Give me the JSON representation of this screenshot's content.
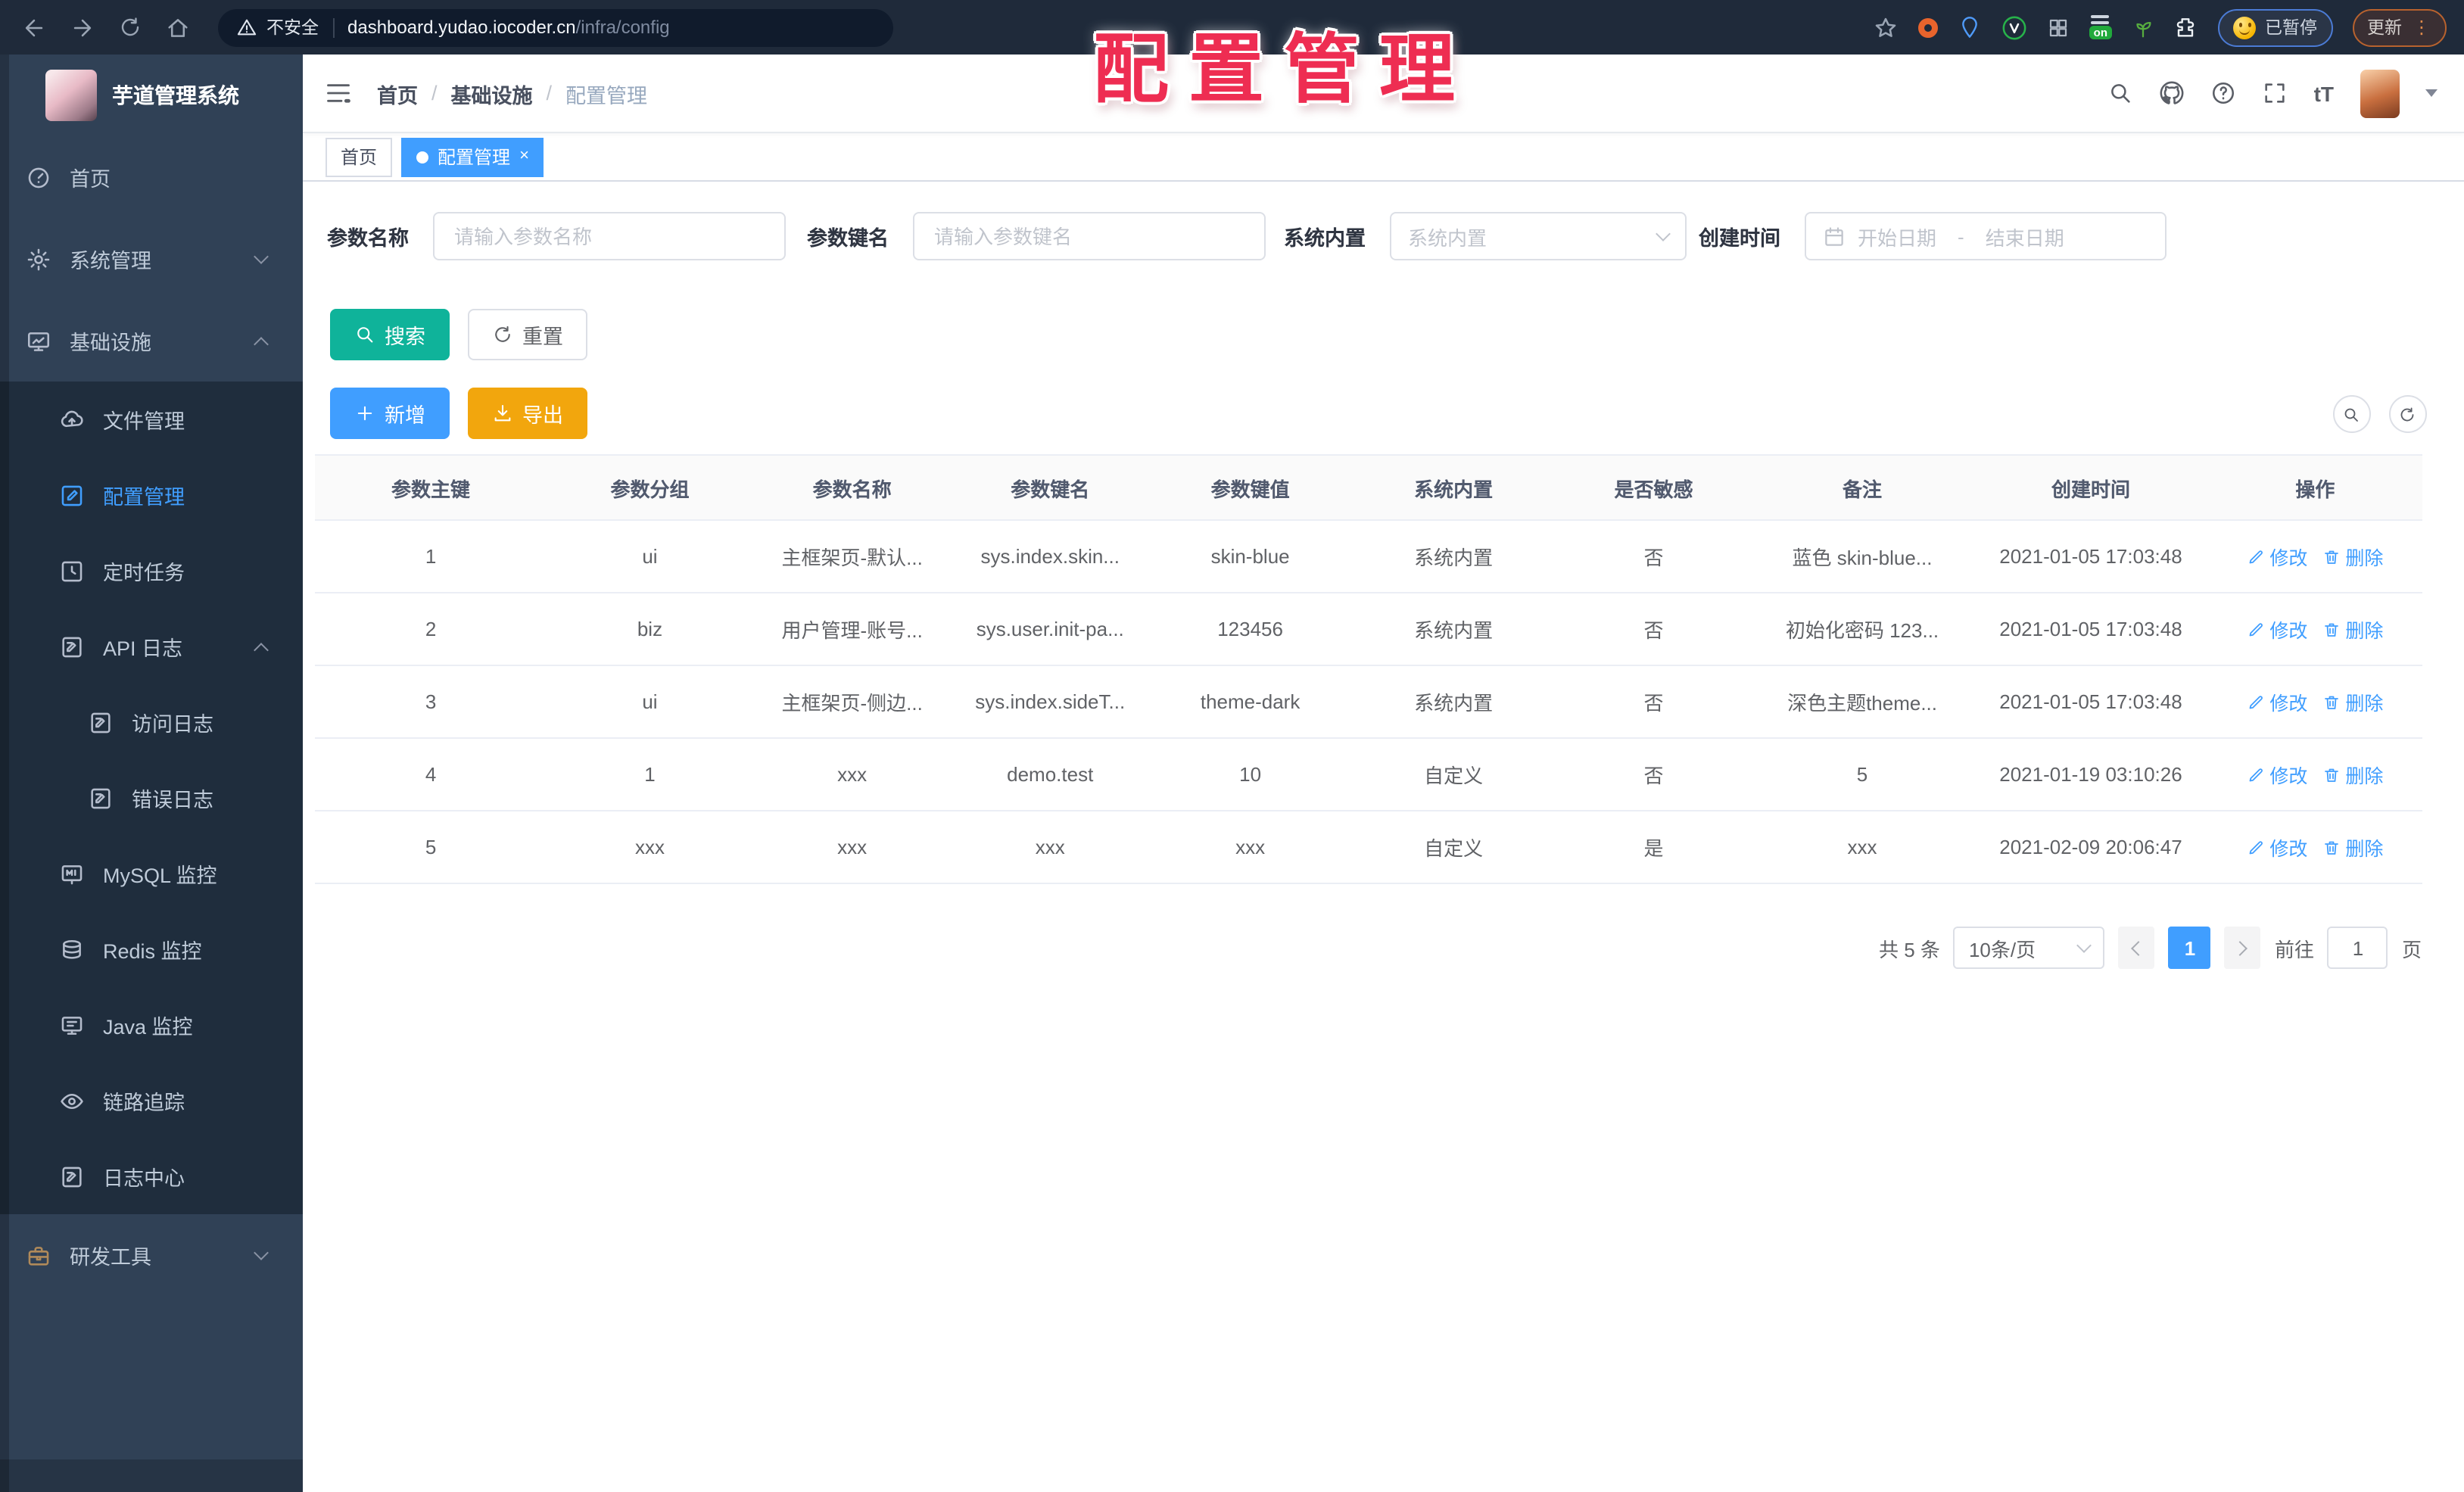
{
  "browser": {
    "security_label": "不安全",
    "url_host": "dashboard.yudao.iocoder.cn",
    "url_path": "/infra/config",
    "extension_on_badge": "on",
    "paused_pill": "已暂停",
    "update_button": "更新",
    "menu_dots": "⋮"
  },
  "watermark": "配置管理",
  "colors": {
    "accent_blue": "#409eff",
    "search_teal": "#0fb39a",
    "export_amber": "#f2a60d",
    "watermark_red": "#ee2d52",
    "sidebar_bg": "#304156",
    "submenu_bg": "#1f2d3d"
  },
  "sidebar": {
    "logo_title": "芋道管理系统",
    "menu": [
      {
        "label": "首页",
        "icon": "dashboard-icon"
      },
      {
        "label": "系统管理",
        "icon": "gear-icon",
        "arrow": "down"
      },
      {
        "label": "基础设施",
        "icon": "infra-monitor-icon",
        "arrow": "up"
      },
      {
        "label": "文件管理",
        "icon": "cloud-upload-icon"
      },
      {
        "label": "配置管理",
        "icon": "edit-square-icon",
        "active": true
      },
      {
        "label": "定时任务",
        "icon": "timer-icon"
      },
      {
        "label": "API 日志",
        "icon": "doc-log-icon",
        "arrow": "up"
      },
      {
        "label": "访问日志",
        "icon": "doc-log-icon"
      },
      {
        "label": "错误日志",
        "icon": "doc-log-icon"
      },
      {
        "label": "MySQL 监控",
        "icon": "mysql-monitor-icon"
      },
      {
        "label": "Redis 监控",
        "icon": "redis-db-icon"
      },
      {
        "label": "Java 监控",
        "icon": "java-monitor-icon"
      },
      {
        "label": "链路追踪",
        "icon": "eye-icon"
      },
      {
        "label": "日志中心",
        "icon": "doc-pen-icon"
      },
      {
        "label": "研发工具",
        "icon": "toolbox-icon",
        "arrow": "down"
      }
    ]
  },
  "header": {
    "breadcrumb": [
      "首页",
      "基础设施",
      "配置管理"
    ],
    "separator": "/",
    "text_size_glyph": "tT"
  },
  "tabs": {
    "home": "首页",
    "active_tab": "配置管理",
    "close_glyph": "×"
  },
  "filters": {
    "name_label": "参数名称",
    "name_placeholder": "请输入参数名称",
    "key_label": "参数键名",
    "key_placeholder": "请输入参数键名",
    "builtin_label": "系统内置",
    "builtin_placeholder": "系统内置",
    "date_label": "创建时间",
    "date_start_placeholder": "开始日期",
    "date_separator": "-",
    "date_end_placeholder": "结束日期"
  },
  "toolbar": {
    "search_label": "搜索",
    "reset_label": "重置",
    "add_label": "新增",
    "export_label": "导出"
  },
  "table": {
    "columns": [
      "参数主键",
      "参数分组",
      "参数名称",
      "参数键名",
      "参数键值",
      "系统内置",
      "是否敏感",
      "备注",
      "创建时间",
      "操作"
    ],
    "edit_label": "修改",
    "delete_label": "删除",
    "rows": [
      [
        "1",
        "ui",
        "主框架页-默认...",
        "sys.index.skin...",
        "skin-blue",
        "系统内置",
        "否",
        "蓝色 skin-blue...",
        "2021-01-05 17:03:48"
      ],
      [
        "2",
        "biz",
        "用户管理-账号...",
        "sys.user.init-pa...",
        "123456",
        "系统内置",
        "否",
        "初始化密码 123...",
        "2021-01-05 17:03:48"
      ],
      [
        "3",
        "ui",
        "主框架页-侧边...",
        "sys.index.sideT...",
        "theme-dark",
        "系统内置",
        "否",
        "深色主题theme...",
        "2021-01-05 17:03:48"
      ],
      [
        "4",
        "1",
        "xxx",
        "demo.test",
        "10",
        "自定义",
        "否",
        "5",
        "2021-01-19 03:10:26"
      ],
      [
        "5",
        "xxx",
        "xxx",
        "xxx",
        "xxx",
        "自定义",
        "是",
        "xxx",
        "2021-02-09 20:06:47"
      ]
    ]
  },
  "pagination": {
    "total_label": "共 5 条",
    "page_size": "10条/页",
    "current_page": "1",
    "goto_label": "前往",
    "goto_value": "1",
    "page_unit": "页"
  }
}
